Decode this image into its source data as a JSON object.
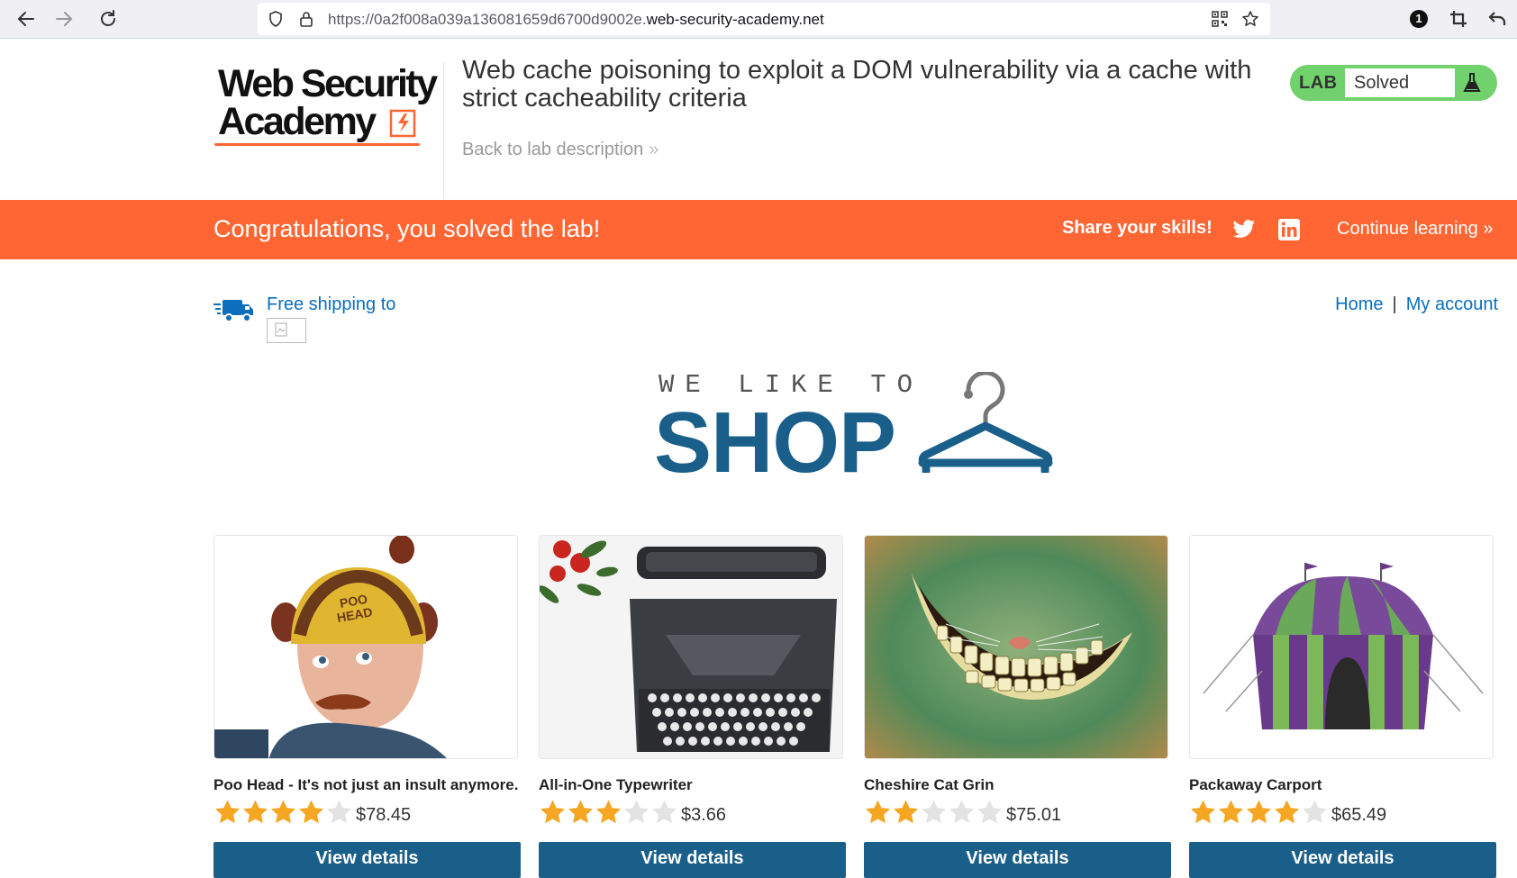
{
  "browser": {
    "url_prefix": "https://0a2f008a039a136081659d6700d9002e.",
    "url_host": "web-security-academy.net",
    "badge_count": "1"
  },
  "header": {
    "logo_line1": "Web Security",
    "logo_line2": "Academy",
    "lab_title": "Web cache poisoning to exploit a DOM vulnerability via a cache with strict cacheability criteria",
    "back_link": "Back to lab description",
    "status_lab": "LAB",
    "status_value": "Solved"
  },
  "banner": {
    "congrats": "Congratulations, you solved the lab!",
    "share": "Share your skills!",
    "continue": "Continue learning"
  },
  "topnav": {
    "shipping": "Free shipping to",
    "home": "Home",
    "separator": "|",
    "account": "My account"
  },
  "hero": {
    "tagline": "WE LIKE TO",
    "title": "SHOP"
  },
  "colors": {
    "brand_orange": "#ff6633",
    "brand_blue": "#1a5f8a",
    "link_blue": "#0a6ebd",
    "solved_green": "#70d16d",
    "star_gold": "#f5a623",
    "star_empty": "#e3e3e3"
  },
  "products": [
    {
      "name": "Poo Head - It's not just an insult anymore.",
      "rating": 4,
      "price": "$78.45",
      "button": "View details",
      "image": "poo-head-hat-image"
    },
    {
      "name": "All-in-One Typewriter",
      "rating": 3,
      "price": "$3.66",
      "button": "View details",
      "image": "typewriter-image"
    },
    {
      "name": "Cheshire Cat Grin",
      "rating": 2,
      "price": "$75.01",
      "button": "View details",
      "image": "cheshire-grin-image"
    },
    {
      "name": "Packaway Carport",
      "rating": 4,
      "price": "$65.49",
      "button": "View details",
      "image": "carport-tent-image"
    }
  ]
}
